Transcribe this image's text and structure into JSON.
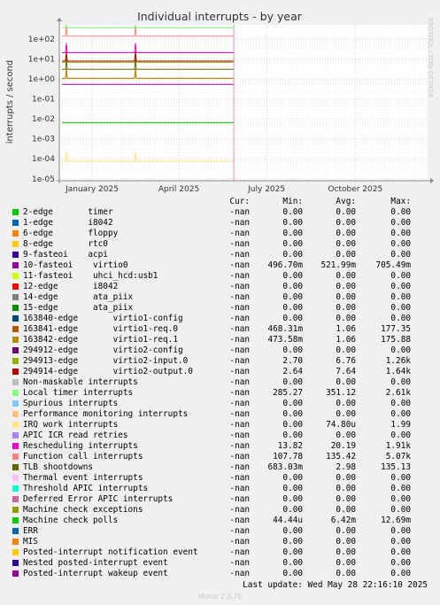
{
  "chart_data": {
    "type": "line",
    "title": "Individual interrupts - by year",
    "ylabel": "interrupts / second",
    "yscale": "log",
    "ylim": [
      8e-06,
      500
    ],
    "yticks": [
      {
        "label": "1e+02",
        "value": 100
      },
      {
        "label": "1e+01",
        "value": 10
      },
      {
        "label": "1e+00",
        "value": 1
      },
      {
        "label": "1e-01",
        "value": 0.1
      },
      {
        "label": "1e-02",
        "value": 0.01
      },
      {
        "label": "1e-03",
        "value": 0.001
      },
      {
        "label": "1e-04",
        "value": 0.0001
      },
      {
        "label": "1e-05",
        "value": 1e-05
      }
    ],
    "xlim": [
      "2024-11-28",
      "2025-12-15"
    ],
    "xticks": [
      {
        "label": "January 2025",
        "date": "2025-01-01"
      },
      {
        "label": "April 2025",
        "date": "2025-04-01"
      },
      {
        "label": "July 2025",
        "date": "2025-07-01"
      },
      {
        "label": "October 2025",
        "date": "2025-10-01"
      }
    ],
    "data_end": "2025-05-28",
    "side_label": "RRDTOOL / TOBI OETIKER",
    "columns": [
      "Cur:",
      "Min:",
      "Avg:",
      "Max:"
    ],
    "series": [
      {
        "name": "2-edge       timer",
        "color": "#00cc00",
        "cur": "-nan",
        "min": "0.00",
        "avg": "0.00",
        "max": "0.00"
      },
      {
        "name": "1-edge       i8042",
        "color": "#0066b3",
        "cur": "-nan",
        "min": "0.00",
        "avg": "0.00",
        "max": "0.00"
      },
      {
        "name": "6-edge       floppy",
        "color": "#ff8000",
        "cur": "-nan",
        "min": "0.00",
        "avg": "0.00",
        "max": "0.00"
      },
      {
        "name": "8-edge       rtc0",
        "color": "#ffcc00",
        "cur": "-nan",
        "min": "0.00",
        "avg": "0.00",
        "max": "0.00"
      },
      {
        "name": "9-fasteoi    acpi",
        "color": "#330099",
        "cur": "-nan",
        "min": "0.00",
        "avg": "0.00",
        "max": "0.00"
      },
      {
        "name": "10-fasteoi    virtio0",
        "color": "#990099",
        "cur": "-nan",
        "min": "496.70m",
        "avg": "521.99m",
        "max": "705.49m"
      },
      {
        "name": "11-fasteoi    uhci_hcd:usb1",
        "color": "#ccff00",
        "cur": "-nan",
        "min": "0.00",
        "avg": "0.00",
        "max": "0.00"
      },
      {
        "name": "12-edge       i8042",
        "color": "#ff0000",
        "cur": "-nan",
        "min": "0.00",
        "avg": "0.00",
        "max": "0.00"
      },
      {
        "name": "14-edge       ata_piix",
        "color": "#808080",
        "cur": "-nan",
        "min": "0.00",
        "avg": "0.00",
        "max": "0.00"
      },
      {
        "name": "15-edge       ata_piix",
        "color": "#008f00",
        "cur": "-nan",
        "min": "0.00",
        "avg": "0.00",
        "max": "0.00"
      },
      {
        "name": "163840-edge       virtio1-config",
        "color": "#00487d",
        "cur": "-nan",
        "min": "0.00",
        "avg": "0.00",
        "max": "0.00"
      },
      {
        "name": "163841-edge       virtio1-req.0",
        "color": "#b35a00",
        "cur": "-nan",
        "min": "468.31m",
        "avg": "1.06",
        "max": "177.35"
      },
      {
        "name": "163842-edge       virtio1-req.1",
        "color": "#b38f00",
        "cur": "-nan",
        "min": "473.58m",
        "avg": "1.06",
        "max": "175.88"
      },
      {
        "name": "294912-edge       virtio2-config",
        "color": "#6b006b",
        "cur": "-nan",
        "min": "0.00",
        "avg": "0.00",
        "max": "0.00"
      },
      {
        "name": "294913-edge       virtio2-input.0",
        "color": "#8fb300",
        "cur": "-nan",
        "min": "2.70",
        "avg": "6.76",
        "max": "1.26k"
      },
      {
        "name": "294914-edge       virtio2-output.0",
        "color": "#b30000",
        "cur": "-nan",
        "min": "2.64",
        "avg": "7.64",
        "max": "1.64k"
      },
      {
        "name": "Non-maskable interrupts",
        "color": "#bebebe",
        "cur": "-nan",
        "min": "0.00",
        "avg": "0.00",
        "max": "0.00"
      },
      {
        "name": "Local timer interrupts",
        "color": "#80ff80",
        "cur": "-nan",
        "min": "285.27",
        "avg": "351.12",
        "max": "2.61k"
      },
      {
        "name": "Spurious interrupts",
        "color": "#80c9ff",
        "cur": "-nan",
        "min": "0.00",
        "avg": "0.00",
        "max": "0.00"
      },
      {
        "name": "Performance monitoring interrupts",
        "color": "#ffc080",
        "cur": "-nan",
        "min": "0.00",
        "avg": "0.00",
        "max": "0.00"
      },
      {
        "name": "IRQ work interrupts",
        "color": "#ffe680",
        "cur": "-nan",
        "min": "0.00",
        "avg": "74.80u",
        "max": "1.99"
      },
      {
        "name": "APIC ICR read retries",
        "color": "#aa80ff",
        "cur": "-nan",
        "min": "0.00",
        "avg": "0.00",
        "max": "0.00"
      },
      {
        "name": "Rescheduling interrupts",
        "color": "#ee00cc",
        "cur": "-nan",
        "min": "13.82",
        "avg": "20.19",
        "max": "1.91k"
      },
      {
        "name": "Function call interrupts",
        "color": "#ff8080",
        "cur": "-nan",
        "min": "107.78",
        "avg": "135.42",
        "max": "5.07k"
      },
      {
        "name": "TLB shootdowns",
        "color": "#666600",
        "cur": "-nan",
        "min": "683.03m",
        "avg": "2.98",
        "max": "135.13"
      },
      {
        "name": "Thermal event interrupts",
        "color": "#ffbfff",
        "cur": "-nan",
        "min": "0.00",
        "avg": "0.00",
        "max": "0.00"
      },
      {
        "name": "Threshold APIC interrupts",
        "color": "#00ffcc",
        "cur": "-nan",
        "min": "0.00",
        "avg": "0.00",
        "max": "0.00"
      },
      {
        "name": "Deferred Error APIC interrupts",
        "color": "#cc6699",
        "cur": "-nan",
        "min": "0.00",
        "avg": "0.00",
        "max": "0.00"
      },
      {
        "name": "Machine check exceptions",
        "color": "#999900",
        "cur": "-nan",
        "min": "0.00",
        "avg": "0.00",
        "max": "0.00"
      },
      {
        "name": "Machine check polls",
        "color": "#00cc00",
        "cur": "-nan",
        "min": "44.44u",
        "avg": "6.42m",
        "max": "12.69m"
      },
      {
        "name": "ERR",
        "color": "#0066b3",
        "cur": "-nan",
        "min": "0.00",
        "avg": "0.00",
        "max": "0.00"
      },
      {
        "name": "MIS",
        "color": "#ff8000",
        "cur": "-nan",
        "min": "0.00",
        "avg": "0.00",
        "max": "0.00"
      },
      {
        "name": "Posted-interrupt notification event",
        "color": "#ffcc00",
        "cur": "-nan",
        "min": "0.00",
        "avg": "0.00",
        "max": "0.00"
      },
      {
        "name": "Nested posted-interrupt event",
        "color": "#330099",
        "cur": "-nan",
        "min": "0.00",
        "avg": "0.00",
        "max": "0.00"
      },
      {
        "name": "Posted-interrupt wakeup event",
        "color": "#990099",
        "cur": "-nan",
        "min": "0.00",
        "avg": "0.00",
        "max": "0.00"
      }
    ]
  },
  "last_update": "Last update: Wed May 28 22:16:10 2025",
  "footer": "Munin 2.0.76"
}
